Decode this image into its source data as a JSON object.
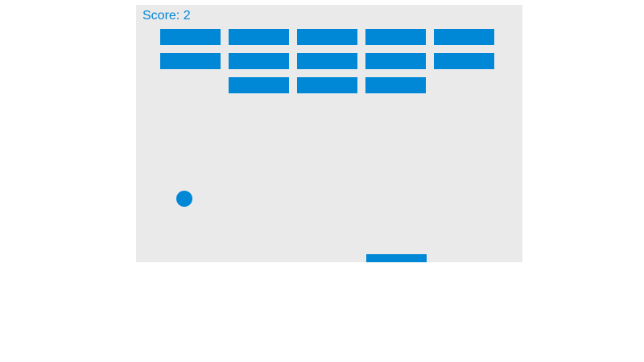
{
  "game": {
    "score_text": "Score: 2",
    "score": 2
  },
  "colors": {
    "primary": "#0087d6",
    "canvas_background": "#eaeaea",
    "page_background": "#ffffff"
  },
  "bricks": {
    "rows": 3,
    "columns": 5,
    "status": [
      [
        true,
        true,
        true,
        true,
        true
      ],
      [
        true,
        true,
        true,
        true,
        true
      ],
      [
        false,
        true,
        true,
        true,
        false
      ]
    ]
  }
}
